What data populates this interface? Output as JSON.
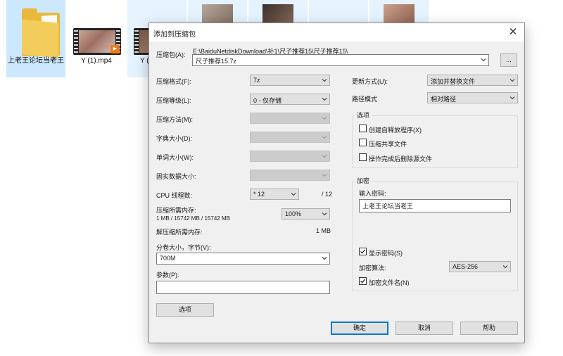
{
  "explorer": {
    "items": [
      {
        "label": "上老王论坛当老王",
        "type": "folder"
      },
      {
        "label": "Y (1).mp4",
        "type": "video"
      },
      {
        "label": "Y (",
        "type": "video"
      }
    ]
  },
  "dialog": {
    "title": "添加到压缩包",
    "archive_label": "压缩包(A):",
    "archive_path": "E:\\BaiduNetdiskDownload\\补1\\尺子推荐15\\尺子推荐15\\",
    "archive_name": "尺子推荐15.7z",
    "browse_label": "...",
    "format": {
      "label": "压缩格式(F):",
      "value": "7z"
    },
    "level": {
      "label": "压缩等级(L):",
      "value": "0 - 仅存储"
    },
    "method": {
      "label": "压缩方法(M):"
    },
    "dictionary": {
      "label": "字典大小(D):"
    },
    "word": {
      "label": "单词大小(W):"
    },
    "solid": {
      "label": "固实数据大小:"
    },
    "threads": {
      "label": "CPU 线程数:",
      "value": "* 12",
      "max": "/ 12"
    },
    "mem_compress": {
      "label": "压缩所需内存:",
      "detail": "1 MB / 15742 MB / 15742 MB",
      "value": "100%"
    },
    "mem_decompress": {
      "label": "解压缩所需内存:",
      "value": "1 MB"
    },
    "volume": {
      "label": "分卷大小，字节(V):",
      "value": "700M"
    },
    "params": {
      "label": "参数(P):",
      "value": ""
    },
    "options_button": "选项",
    "update_mode": {
      "label": "更新方式(U):",
      "value": "添加并替换文件"
    },
    "path_mode": {
      "label": "路径模式",
      "value": "相对路径"
    },
    "options_group": {
      "title": "选项",
      "sfx": "创建自释放程序(X)",
      "shared": "压缩共享文件",
      "delete_after": "操作完成后删除源文件"
    },
    "encryption": {
      "title": "加密",
      "password_label": "输入密码:",
      "password_value": "上老王论坛当老王",
      "show_password": "显示密码(S)",
      "method_label": "加密算法:",
      "method_value": "AES-256",
      "encrypt_names": "加密文件名(N)"
    },
    "ok": "确定",
    "cancel": "取消",
    "help": "帮助"
  },
  "colors": {
    "accent": "#0078d7",
    "folder": "#f3cd5c",
    "selected": "#cce8ff"
  }
}
